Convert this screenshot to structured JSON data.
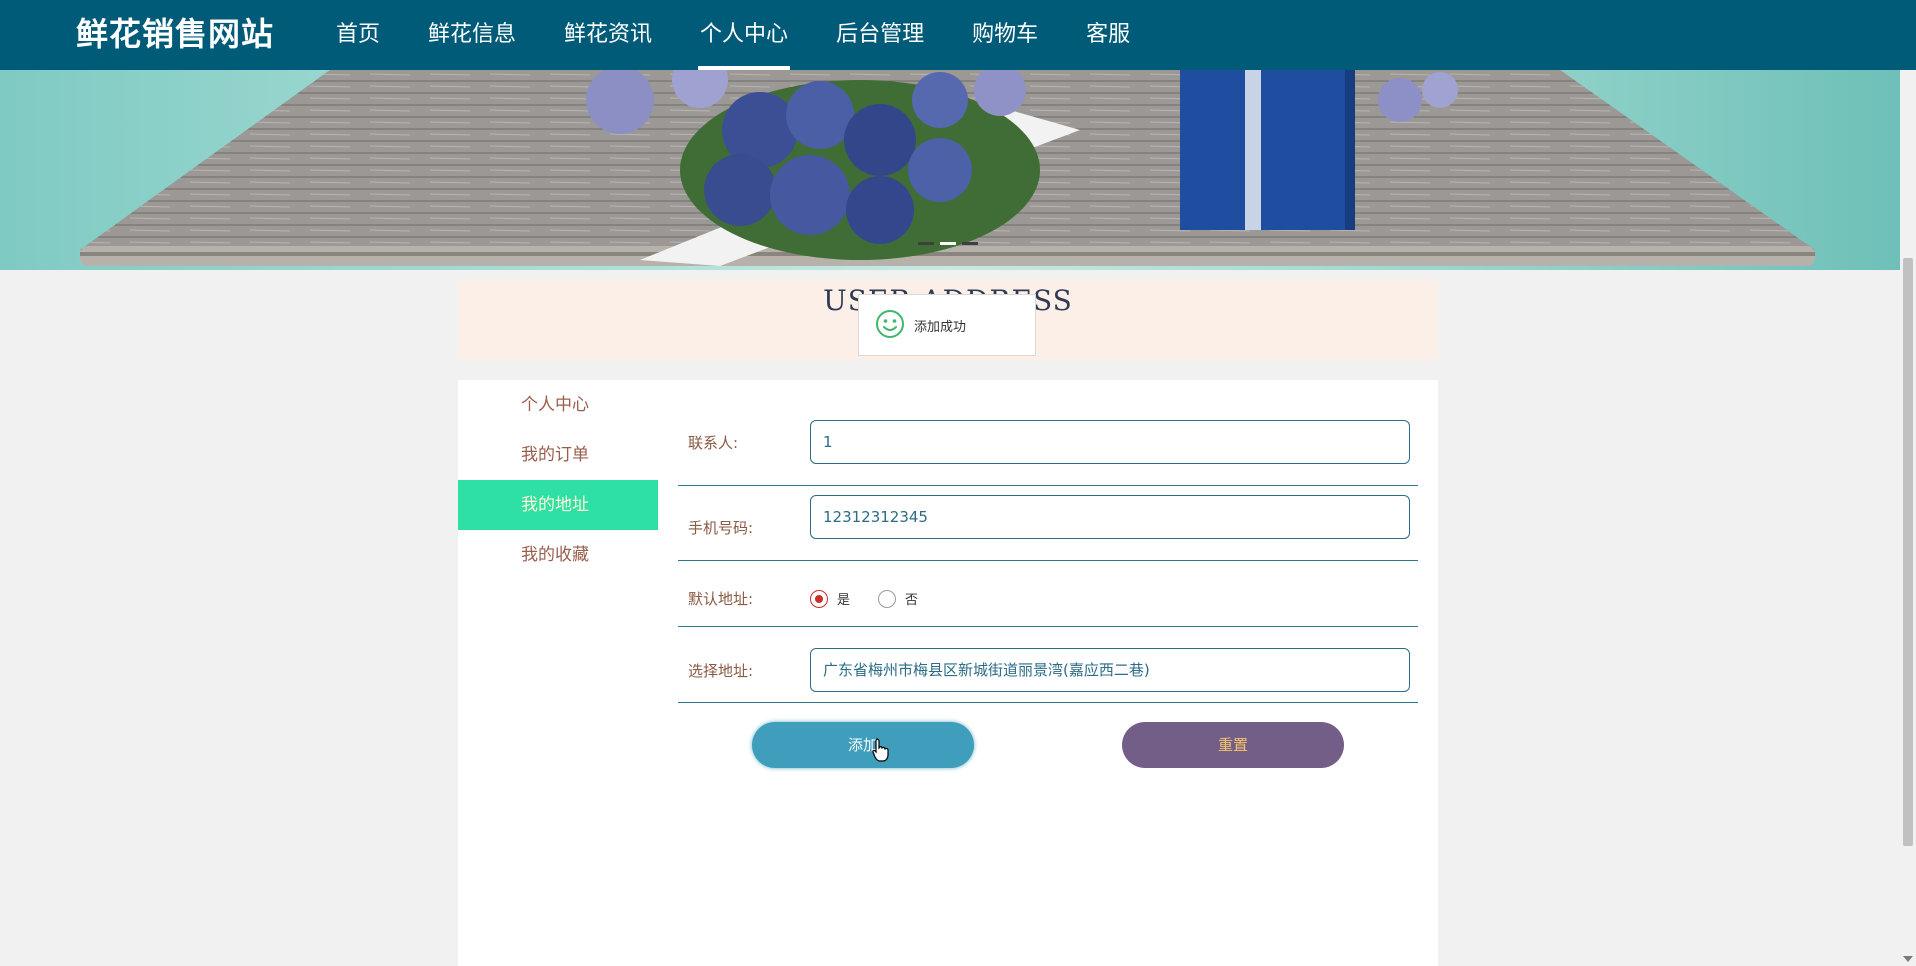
{
  "site": {
    "brand": "鲜花销售网站"
  },
  "nav": {
    "items": [
      {
        "label": "首页"
      },
      {
        "label": "鲜花信息"
      },
      {
        "label": "鲜花资讯"
      },
      {
        "label": "个人中心",
        "active": true
      },
      {
        "label": "后台管理"
      },
      {
        "label": "购物车"
      },
      {
        "label": "客服"
      }
    ]
  },
  "page": {
    "title": "USER ADDRESS"
  },
  "toast": {
    "message": "添加成功",
    "icon": "smile-icon"
  },
  "sidebar": {
    "items": [
      {
        "label": "个人中心"
      },
      {
        "label": "我的订单"
      },
      {
        "label": "我的地址",
        "active": true
      },
      {
        "label": "我的收藏"
      }
    ]
  },
  "form": {
    "contact": {
      "label": "联系人:",
      "value": "1"
    },
    "phone": {
      "label": "手机号码:",
      "value": "12312312345"
    },
    "default_address": {
      "label": "默认地址:",
      "options": [
        {
          "label": "是",
          "checked": true
        },
        {
          "label": "否",
          "checked": false
        }
      ]
    },
    "address": {
      "label": "选择地址:",
      "value": "广东省梅州市梅县区新城街道丽景湾(嘉应西二巷)"
    },
    "add_button": "添加",
    "reset_button": "重置"
  },
  "colors": {
    "nav_bg": "#005b79",
    "sidebar_active": "#2fe0a6",
    "add_button": "#3f9ebc",
    "reset_button": "#735e87"
  }
}
